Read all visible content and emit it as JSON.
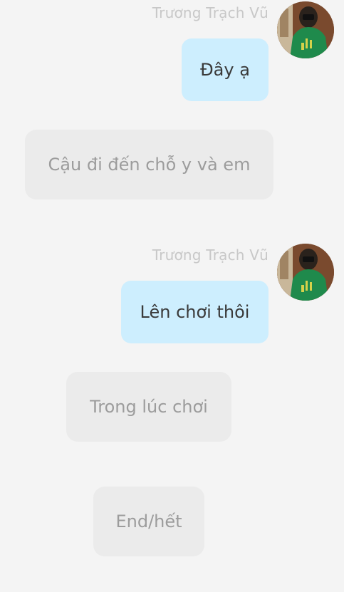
{
  "messages": [
    {
      "sender": "Trương Trạch Vũ",
      "text": "Đây ạ",
      "avatar_icon": "avatar-photo-icon"
    },
    {
      "sender": "Trương Trạch Vũ",
      "text": "Lên chơi thôi",
      "avatar_icon": "avatar-photo-icon"
    }
  ],
  "choices": [
    {
      "label": "Cậu đi đến chỗ y và em"
    },
    {
      "label": "Trong lúc chơi"
    },
    {
      "label": "End/hết"
    }
  ],
  "colors": {
    "background": "#f4f4f4",
    "outgoing_bubble": "#cdeefe",
    "choice_bubble": "#ebebeb",
    "sender_name": "#c8c8c8"
  }
}
